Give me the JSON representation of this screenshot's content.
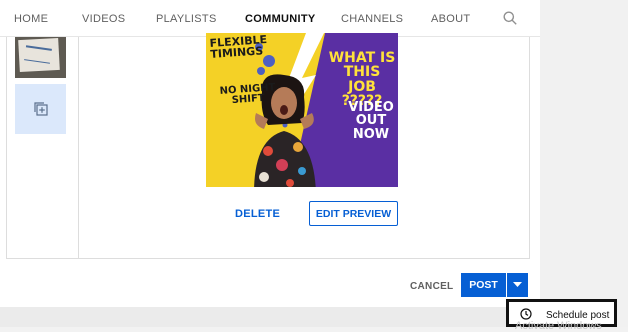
{
  "nav": {
    "tabs": [
      {
        "label": "HOME",
        "active": false
      },
      {
        "label": "VIDEOS",
        "active": false
      },
      {
        "label": "PLAYLISTS",
        "active": false
      },
      {
        "label": "COMMUNITY",
        "active": true
      },
      {
        "label": "CHANNELS",
        "active": false
      },
      {
        "label": "ABOUT",
        "active": false
      }
    ],
    "search_icon": "search-icon"
  },
  "thumbnail": {
    "caption_lines": [
      "FLEXIBLE",
      "TIMINGS"
    ],
    "caption2_lines": [
      "NO NIGHT",
      "SHIFT"
    ],
    "headline_lines": [
      "WHAT IS THIS",
      "JOB ?????"
    ],
    "cta_lines": [
      "VIDEO",
      "OUT NOW"
    ]
  },
  "actions": {
    "delete": "DELETE",
    "edit_preview": "EDIT PREVIEW",
    "cancel": "CANCEL",
    "post": "POST"
  },
  "menu": {
    "schedule_post": "Schedule post",
    "overlay_text": "Activate Windows"
  },
  "colors": {
    "accent": "#065fd4",
    "thumb_yellow": "#f4d126",
    "thumb_purple": "#5a2fa3"
  }
}
